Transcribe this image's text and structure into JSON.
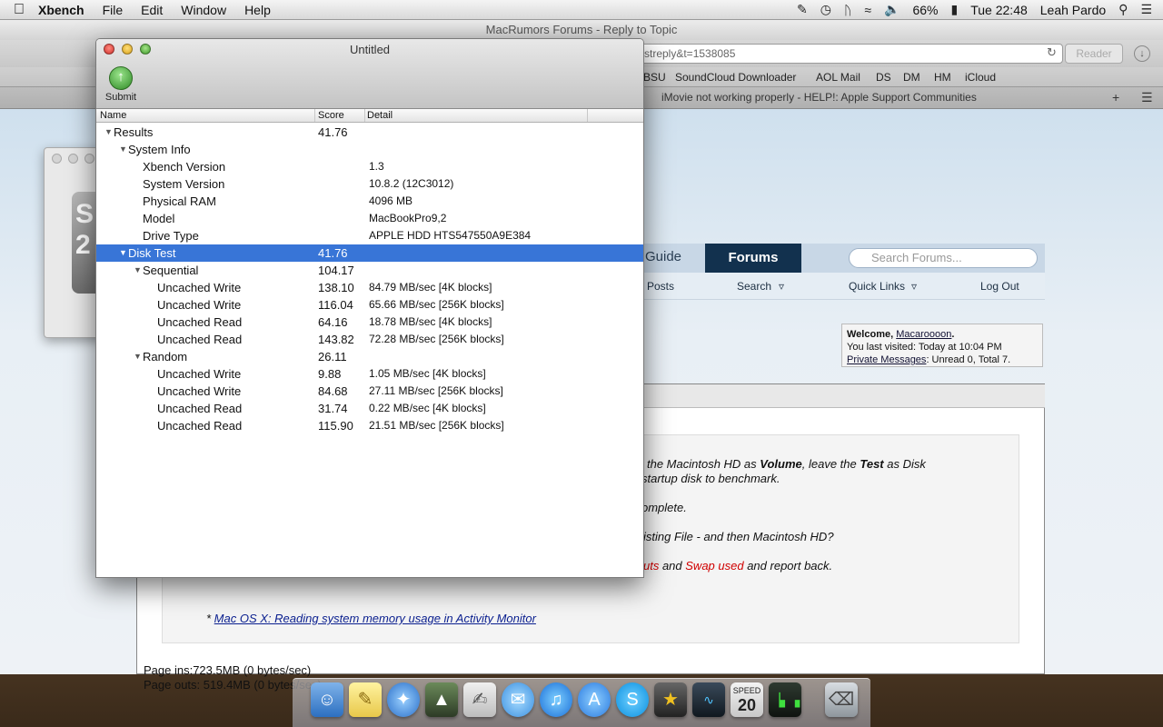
{
  "menubar": {
    "app": "Xbench",
    "menus": [
      "File",
      "Edit",
      "Window",
      "Help"
    ],
    "battery": "66%",
    "clock": "Tue 22:48",
    "user": "Leah Pardo"
  },
  "safari": {
    "title": "MacRumors Forums - Reply to Topic",
    "url": "streply&t=1538085",
    "reader": "Reader",
    "bookmarks": [
      "BSU",
      "SoundCloud Downloader",
      "AOL Mail",
      "DS",
      "DM",
      "HM",
      "iCloud"
    ],
    "tab_title": "iMovie not working properly - HELP!: Apple Support Communities"
  },
  "forum": {
    "nav_guide": "Guide",
    "nav_forums": "Forums",
    "search_placeholder": "Search Forums...",
    "sub_new_posts": "w Posts",
    "sub_search": "Search",
    "sub_quick_links": "Quick Links",
    "sub_logout": "Log Out",
    "welcome_prefix": "Welcome, ",
    "welcome_user": "Macaroooon",
    "welcome_suffix": ".",
    "last_visited_prefix": "You last visited: Today at ",
    "last_visited_time": "10:04 PM",
    "pm_link": "Private Messages",
    "pm_suffix": ": Unread 0, Total 7.",
    "quote_l1_a": "the Macintosh HD as ",
    "quote_l1_b": "Volume",
    "quote_l1_c": ", leave the ",
    "quote_l1_d": "Test",
    "quote_l1_e": " as Disk",
    "quote_l2": "startup disk to benchmark.",
    "quote_l3": "omplete.",
    "quote_l4": "isting File - and then Macintosh HD?",
    "quote_l5_a": "uts",
    "quote_l5_b": " and ",
    "quote_l5_c": "Swap used",
    "quote_l5_d": " and report back.",
    "quote_link_prefix": "* ",
    "quote_link": "Mac OS X: Reading system memory usage in Activity Monitor",
    "page_ins": "Page ins:723.5MB (0 bytes/sec)",
    "page_outs": "Page outs: 519.4MB (0 bytes/sec)"
  },
  "xbench": {
    "title": "Untitled",
    "submit_label": "Submit",
    "col_name": "Name",
    "col_score": "Score",
    "col_detail": "Detail",
    "rows": [
      {
        "name": "Results",
        "score": "41.76",
        "detail": ""
      },
      {
        "name": "System Info",
        "score": "",
        "detail": ""
      },
      {
        "name": "Xbench Version",
        "score": "",
        "detail": "1.3"
      },
      {
        "name": "System Version",
        "score": "",
        "detail": "10.8.2 (12C3012)"
      },
      {
        "name": "Physical RAM",
        "score": "",
        "detail": "4096 MB"
      },
      {
        "name": "Model",
        "score": "",
        "detail": "MacBookPro9,2"
      },
      {
        "name": "Drive Type",
        "score": "",
        "detail": "APPLE HDD HTS547550A9E384"
      },
      {
        "name": "Disk Test",
        "score": "41.76",
        "detail": ""
      },
      {
        "name": "Sequential",
        "score": "104.17",
        "detail": ""
      },
      {
        "name": "Uncached Write",
        "score": "138.10",
        "detail": "84.79 MB/sec [4K blocks]"
      },
      {
        "name": "Uncached Write",
        "score": "116.04",
        "detail": "65.66 MB/sec [256K blocks]"
      },
      {
        "name": "Uncached Read",
        "score": "64.16",
        "detail": "18.78 MB/sec [4K blocks]"
      },
      {
        "name": "Uncached Read",
        "score": "143.82",
        "detail": "72.28 MB/sec [256K blocks]"
      },
      {
        "name": "Random",
        "score": "26.11",
        "detail": ""
      },
      {
        "name": "Uncached Write",
        "score": "9.88",
        "detail": "1.05 MB/sec [4K blocks]"
      },
      {
        "name": "Uncached Write",
        "score": "84.68",
        "detail": "27.11 MB/sec [256K blocks]"
      },
      {
        "name": "Uncached Read",
        "score": "31.74",
        "detail": "0.22 MB/sec [4K blocks]"
      },
      {
        "name": "Uncached Read",
        "score": "115.90",
        "detail": "21.51 MB/sec [256K blocks]"
      }
    ]
  },
  "dock": {
    "speed_badge": "SPEED",
    "speed_number": "20"
  }
}
